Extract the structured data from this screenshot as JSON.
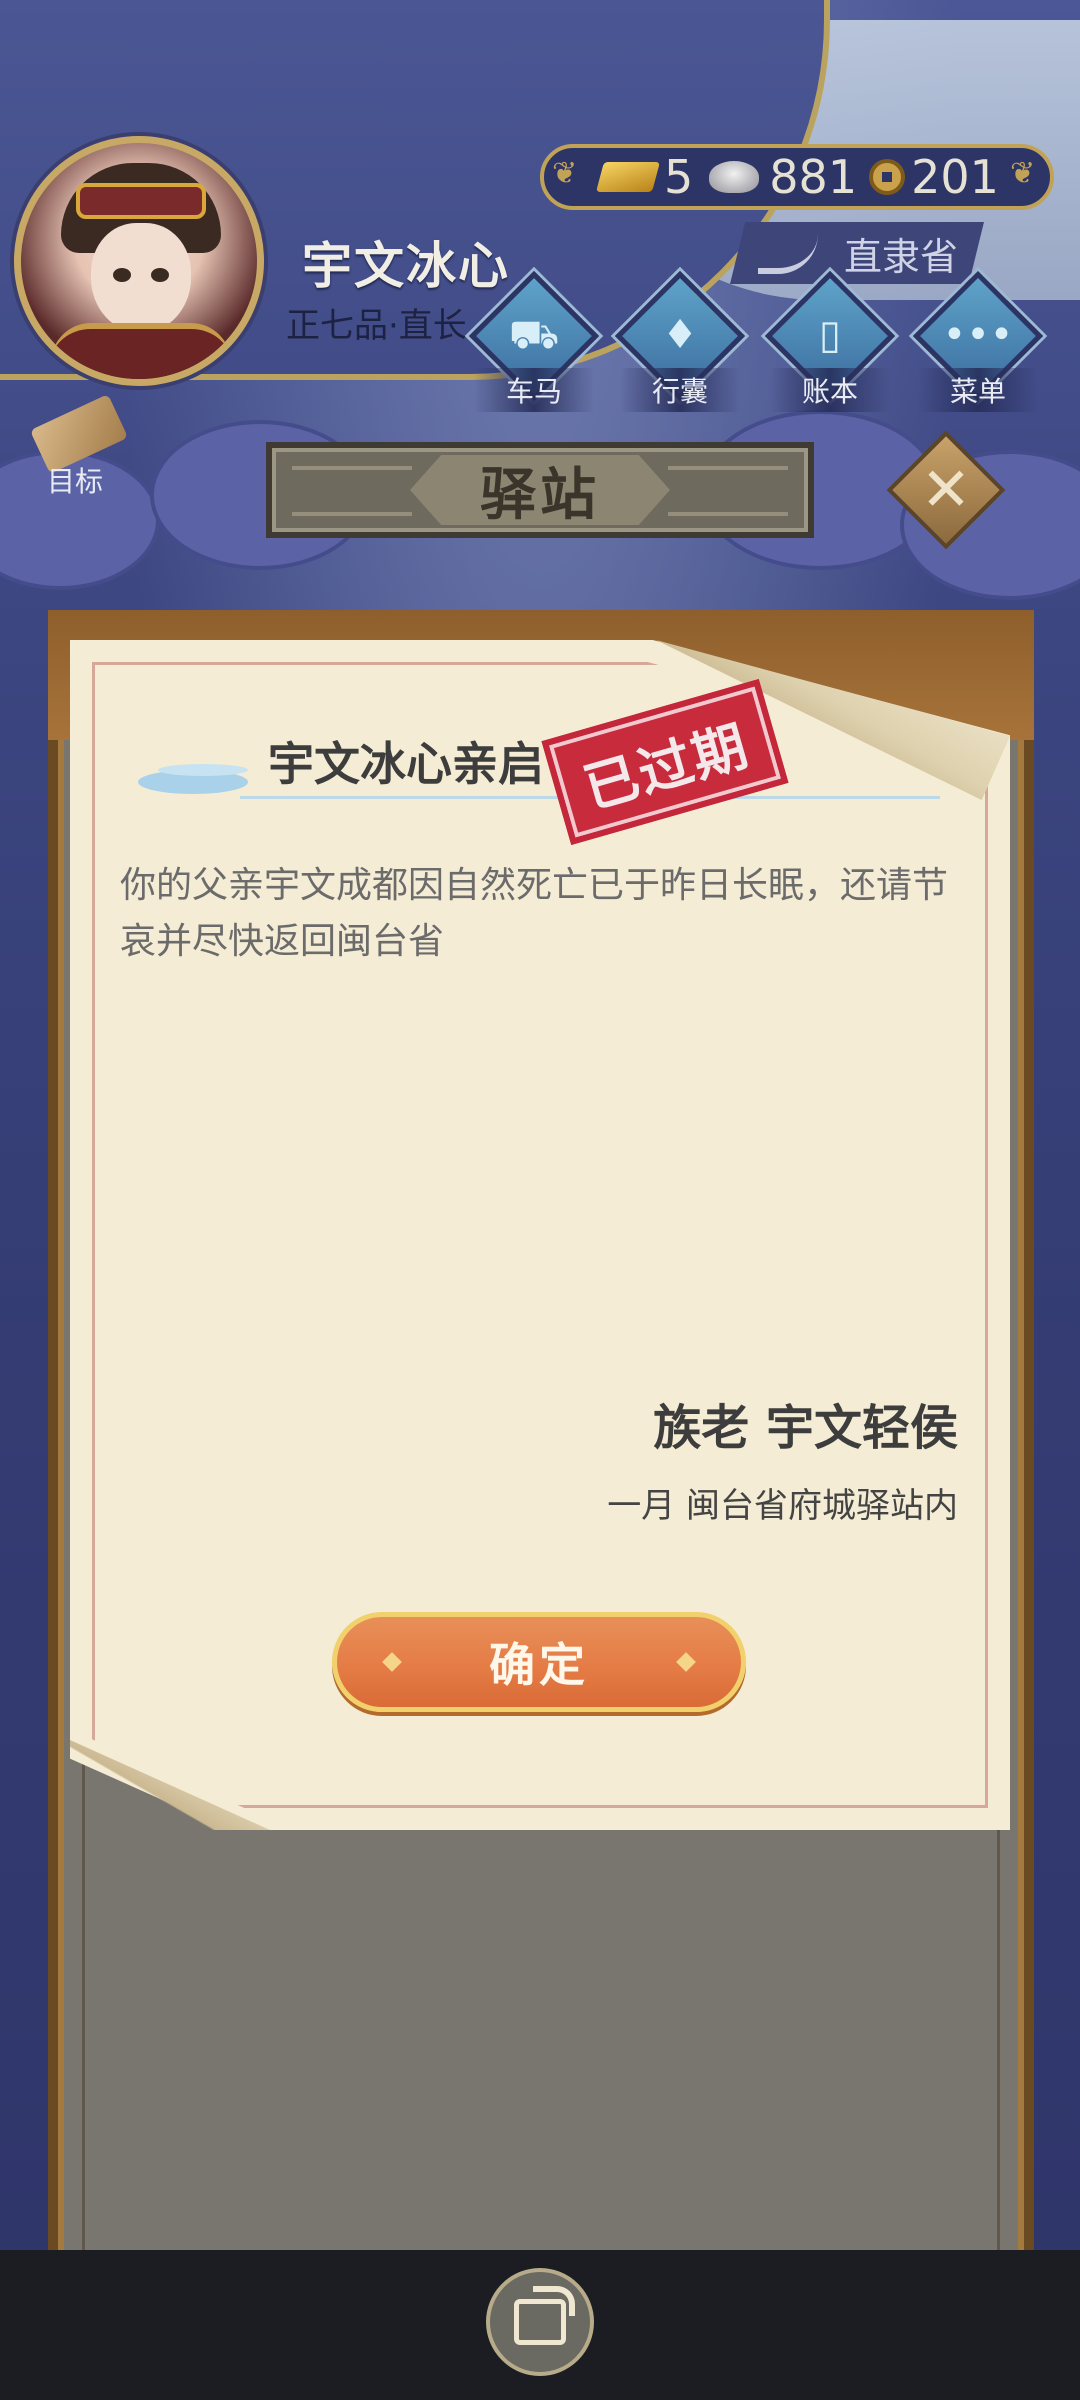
{
  "player": {
    "name": "宇文冰心",
    "rank": "正七品·直长",
    "province": "直隶省"
  },
  "currency": {
    "gold": "5",
    "silver": "881",
    "coins": "201"
  },
  "hud_buttons": [
    {
      "label": "车马",
      "icon": "carriage-icon"
    },
    {
      "label": "行囊",
      "icon": "bag-icon"
    },
    {
      "label": "账本",
      "icon": "ledger-icon"
    },
    {
      "label": "菜单",
      "icon": "menu-icon"
    }
  ],
  "goal": {
    "label": "目标",
    "icon": "scroll-icon"
  },
  "screen_title": "驿站",
  "letter": {
    "recipient": "宇文冰心亲启",
    "stamp": "已过期",
    "message": "你的父亲宇文成都因自然死亡已于昨日长眠，还请节哀并尽快返回闽台省",
    "signature": "族老 宇文轻侯",
    "dateline": "一月 闽台省府城驿站内",
    "confirm_label": "确定"
  },
  "colors": {
    "stamp_red": "#c82b3c",
    "button_orange": "#e57c46",
    "paper": "#f4ecd4"
  }
}
